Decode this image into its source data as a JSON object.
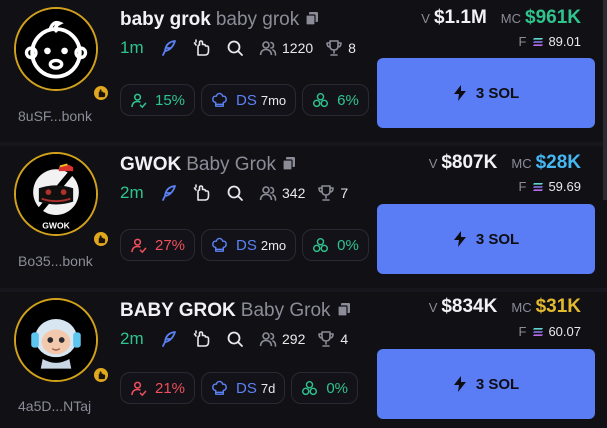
{
  "tokens": [
    {
      "symbol": "baby grok",
      "name": "baby grok",
      "age": "1m",
      "holders": "1220",
      "trophies": "8",
      "creator": "8uSF...bonk",
      "pill_top10": "15%",
      "pill_top10_color": "#2fc48d",
      "dev_label": "DS",
      "dev_age": "7mo",
      "pill_bundle": "6%",
      "v_label": "V",
      "volume": "$1.1M",
      "mc_label": "MC",
      "market_cap": "$961K",
      "mc_color": "#2fc48d",
      "f_label": "F",
      "fee": "89.01",
      "buy_label": "3 SOL"
    },
    {
      "symbol": "GWOK",
      "name": "Baby Grok",
      "age": "2m",
      "holders": "342",
      "trophies": "7",
      "creator": "Bo35...bonk",
      "pill_top10": "27%",
      "pill_top10_color": "#ee4f5c",
      "dev_label": "DS",
      "dev_age": "2mo",
      "pill_bundle": "0%",
      "v_label": "V",
      "volume": "$807K",
      "mc_label": "MC",
      "market_cap": "$28K",
      "mc_color": "#45b7f2",
      "f_label": "F",
      "fee": "59.69",
      "buy_label": "3 SOL",
      "avatar_text": "GWOK"
    },
    {
      "symbol": "BABY GROK",
      "name": "Baby Grok",
      "age": "2m",
      "holders": "292",
      "trophies": "4",
      "creator": "4a5D...NTaj",
      "pill_top10": "21%",
      "pill_top10_color": "#ee4f5c",
      "dev_label": "DS",
      "dev_age": "7d",
      "pill_bundle": "0%",
      "v_label": "V",
      "volume": "$834K",
      "mc_label": "MC",
      "market_cap": "$31K",
      "mc_color": "#e3b92e",
      "f_label": "F",
      "fee": "60.07",
      "buy_label": "3 SOL"
    }
  ],
  "colors": {
    "accent": "#5a7cf4",
    "green": "#2fc48d",
    "red": "#ee4f5c",
    "gold": "#d2a11c"
  },
  "icons": [
    "copy-icon",
    "feather-icon",
    "hand-icon",
    "search-icon",
    "users-icon",
    "trophy-icon",
    "user-check-icon",
    "chef-hat-icon",
    "bundle-icon",
    "lightning-icon",
    "solana-icon",
    "badge-hand-icon"
  ]
}
